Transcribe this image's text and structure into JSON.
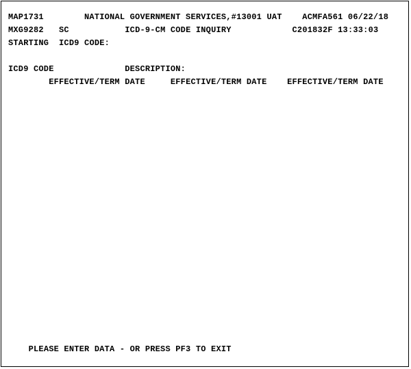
{
  "header": {
    "screen_id": "MAP1731",
    "title": "NATIONAL GOVERNMENT SERVICES,#13001 UAT",
    "system_code": "ACMFA561",
    "date": "06/22/18",
    "session_id": "MXG9282",
    "region": "SC",
    "subtitle": "ICD-9-CM CODE INQUIRY",
    "program_code": "C201832F",
    "time": "13:33:03"
  },
  "fields": {
    "starting_label": "STARTING",
    "icd9_code_label": "ICD9 CODE:",
    "icd9_code_col": "ICD9 CODE",
    "description_col": "DESCRIPTION:",
    "eff_term_col": "EFFECTIVE/TERM DATE"
  },
  "footer": {
    "message": "PLEASE ENTER DATA - OR PRESS PF3 TO EXIT"
  }
}
